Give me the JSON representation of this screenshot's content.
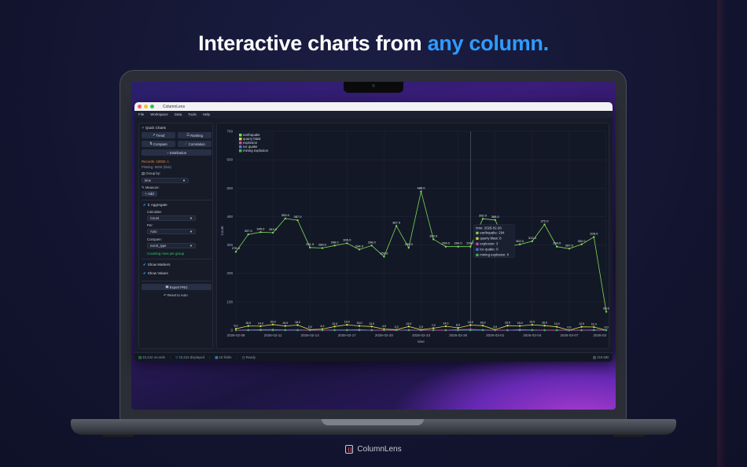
{
  "headline": {
    "prefix": "Interactive charts from ",
    "accent": "any column."
  },
  "brand": {
    "name": "ColumnLens"
  },
  "window": {
    "title": "ColumnLens",
    "menu": [
      "File",
      "Workspace",
      "Data",
      "Tools",
      "Help"
    ]
  },
  "sidebar": {
    "quick_charts_label": "Quick Charts",
    "buttons": {
      "trend": "Trend",
      "ranking": "Ranking",
      "compare": "Compare",
      "correlation": "Correlation",
      "distribution": "Distribution"
    },
    "records_label": "Records: 10000",
    "plotting_label": "Plotting: 5000 (limit)",
    "group_by_label": "Group by:",
    "group_by_value": "time",
    "measure_label": "Measure:",
    "add_label": "Add",
    "aggregate_label": "Aggregate",
    "calculate_label": "Calculate:",
    "calculate_value": "Count",
    "per_label": "Per:",
    "per_value": "Auto",
    "compare_label": "Compare:",
    "compare_value": "event_type",
    "counting_note": "Counting rows per group",
    "show_markers": "Show Markers",
    "show_values": "Show Values",
    "export_png": "Export PNG",
    "reset_auto": "Reset to Auto"
  },
  "status": {
    "records": "10,242 records",
    "displayed": "10,242 displayed",
    "fields": "15 fields",
    "state": "Ready",
    "memory": "219 MB"
  },
  "chart_data": {
    "type": "line",
    "xlabel": "time",
    "ylabel": "Count",
    "ylim": [
      0,
      700
    ],
    "yticks": [
      0,
      100,
      200,
      300,
      400,
      500,
      600,
      700
    ],
    "xtick_labels": [
      "2026-02-08",
      "2026-02-11",
      "2026-02-14",
      "2026-02-17",
      "2026-02-20",
      "2026-02-23",
      "2026-02-26",
      "2026-03-01",
      "2026-03-04",
      "2026-03-07",
      "2026-03"
    ],
    "grid": true,
    "legend_position": "top-left",
    "series": [
      {
        "name": "earthquake",
        "color": "#7ed957",
        "values": [
          276,
          337,
          345,
          343,
          393,
          387,
          291,
          289,
          298,
          306,
          284,
          298,
          259,
          367,
          290,
          488,
          320,
          294,
          294,
          294,
          392,
          388,
          294,
          302,
          313,
          372,
          294,
          287,
          302,
          328,
          65
        ]
      },
      {
        "name": "quarry blast",
        "color": "#d4d94a",
        "values": [
          5,
          15,
          14,
          20,
          15,
          18,
          2,
          4,
          13,
          19,
          15,
          13,
          4,
          2,
          13,
          2,
          7,
          14,
          8,
          18,
          16,
          2,
          16,
          15,
          19,
          16,
          12,
          0,
          12,
          11,
          0
        ]
      },
      {
        "name": "explosion",
        "color": "#d94aa8",
        "values": [
          0,
          1,
          2,
          2,
          1,
          1,
          0,
          0,
          1,
          1,
          2,
          0,
          0,
          0,
          1,
          0,
          0,
          0,
          2,
          3,
          1,
          0,
          0,
          2,
          1,
          0,
          0,
          0,
          0,
          1,
          0
        ]
      },
      {
        "name": "ice quake",
        "color": "#4a7ad9",
        "values": [
          0,
          0,
          0,
          0,
          0,
          0,
          0,
          0,
          0,
          0,
          0,
          0,
          0,
          0,
          0,
          0,
          0,
          0,
          0,
          0,
          0,
          0,
          0,
          0,
          0,
          0,
          0,
          0,
          0,
          0,
          0
        ]
      },
      {
        "name": "mining explosion",
        "color": "#3fb94f",
        "values": [
          0,
          0,
          0,
          0,
          0,
          0,
          0,
          0,
          0,
          0,
          0,
          0,
          0,
          0,
          0,
          0,
          0,
          0,
          0,
          0,
          0,
          0,
          0,
          0,
          0,
          0,
          0,
          0,
          0,
          0,
          0
        ]
      }
    ],
    "tooltip": {
      "title": "time: 2026-02-26",
      "lines": [
        "earthquake: 294",
        "quarry blast: 8",
        "explosion: 3",
        "ice quake: 0",
        "mining explosion: 0"
      ]
    }
  }
}
